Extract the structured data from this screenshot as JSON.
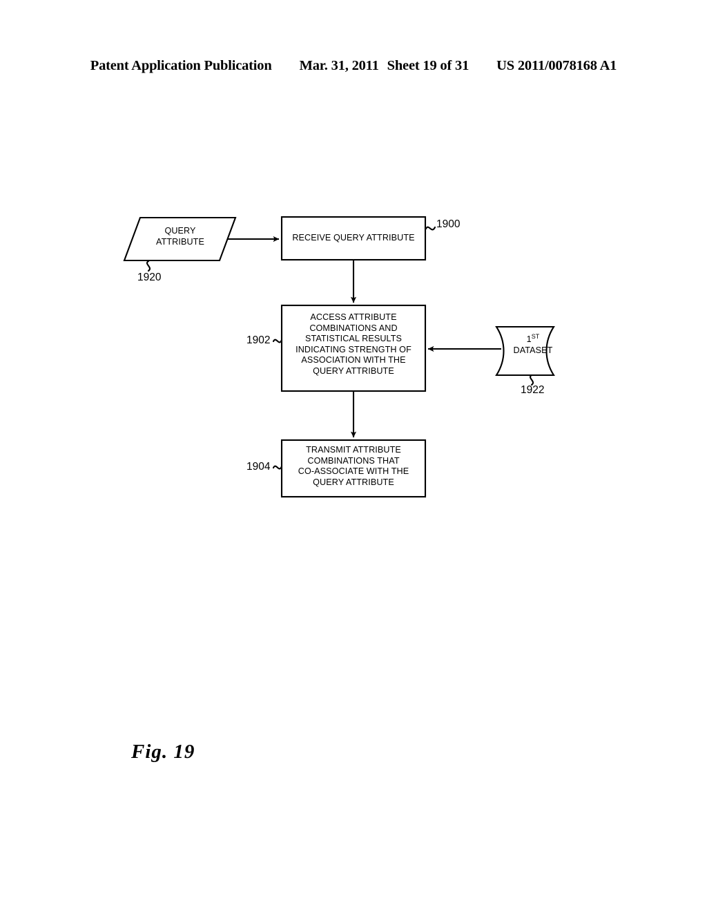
{
  "header": {
    "publication_label": "Patent Application Publication",
    "date": "Mar. 31, 2011",
    "sheet": "Sheet 19 of 31",
    "patent_number": "US 2011/0078168 A1"
  },
  "figure": {
    "caption": "Fig. 19",
    "nodes": {
      "query_attribute_input": {
        "shape": "parallelogram",
        "text": "QUERY\nATTRIBUTE",
        "ref": "1920"
      },
      "receive_step": {
        "shape": "rectangle",
        "text": "RECEIVE QUERY ATTRIBUTE",
        "ref": "1900"
      },
      "access_step": {
        "shape": "rectangle",
        "text": "ACCESS ATTRIBUTE\nCOMBINATIONS AND\nSTATISTICAL RESULTS\nINDICATING STRENGTH OF\nASSOCIATION WITH THE\nQUERY ATTRIBUTE",
        "ref": "1902"
      },
      "transmit_step": {
        "shape": "rectangle",
        "text": "TRANSMIT ATTRIBUTE\nCOMBINATIONS THAT\nCO-ASSOCIATE WITH THE\nQUERY ATTRIBUTE",
        "ref": "1904"
      },
      "first_dataset": {
        "shape": "data-store",
        "text_line1_base": "1",
        "text_line1_sup": "ST",
        "text_line2": "DATASET",
        "ref": "1922"
      }
    },
    "connectors": [
      {
        "from": "query_attribute_input",
        "to": "receive_step",
        "direction": "right"
      },
      {
        "from": "receive_step",
        "to": "access_step",
        "direction": "down"
      },
      {
        "from": "access_step",
        "to": "transmit_step",
        "direction": "down"
      },
      {
        "from": "first_dataset",
        "to": "access_step",
        "direction": "left"
      }
    ],
    "colors": {
      "stroke": "#000000",
      "background": "#ffffff"
    }
  }
}
